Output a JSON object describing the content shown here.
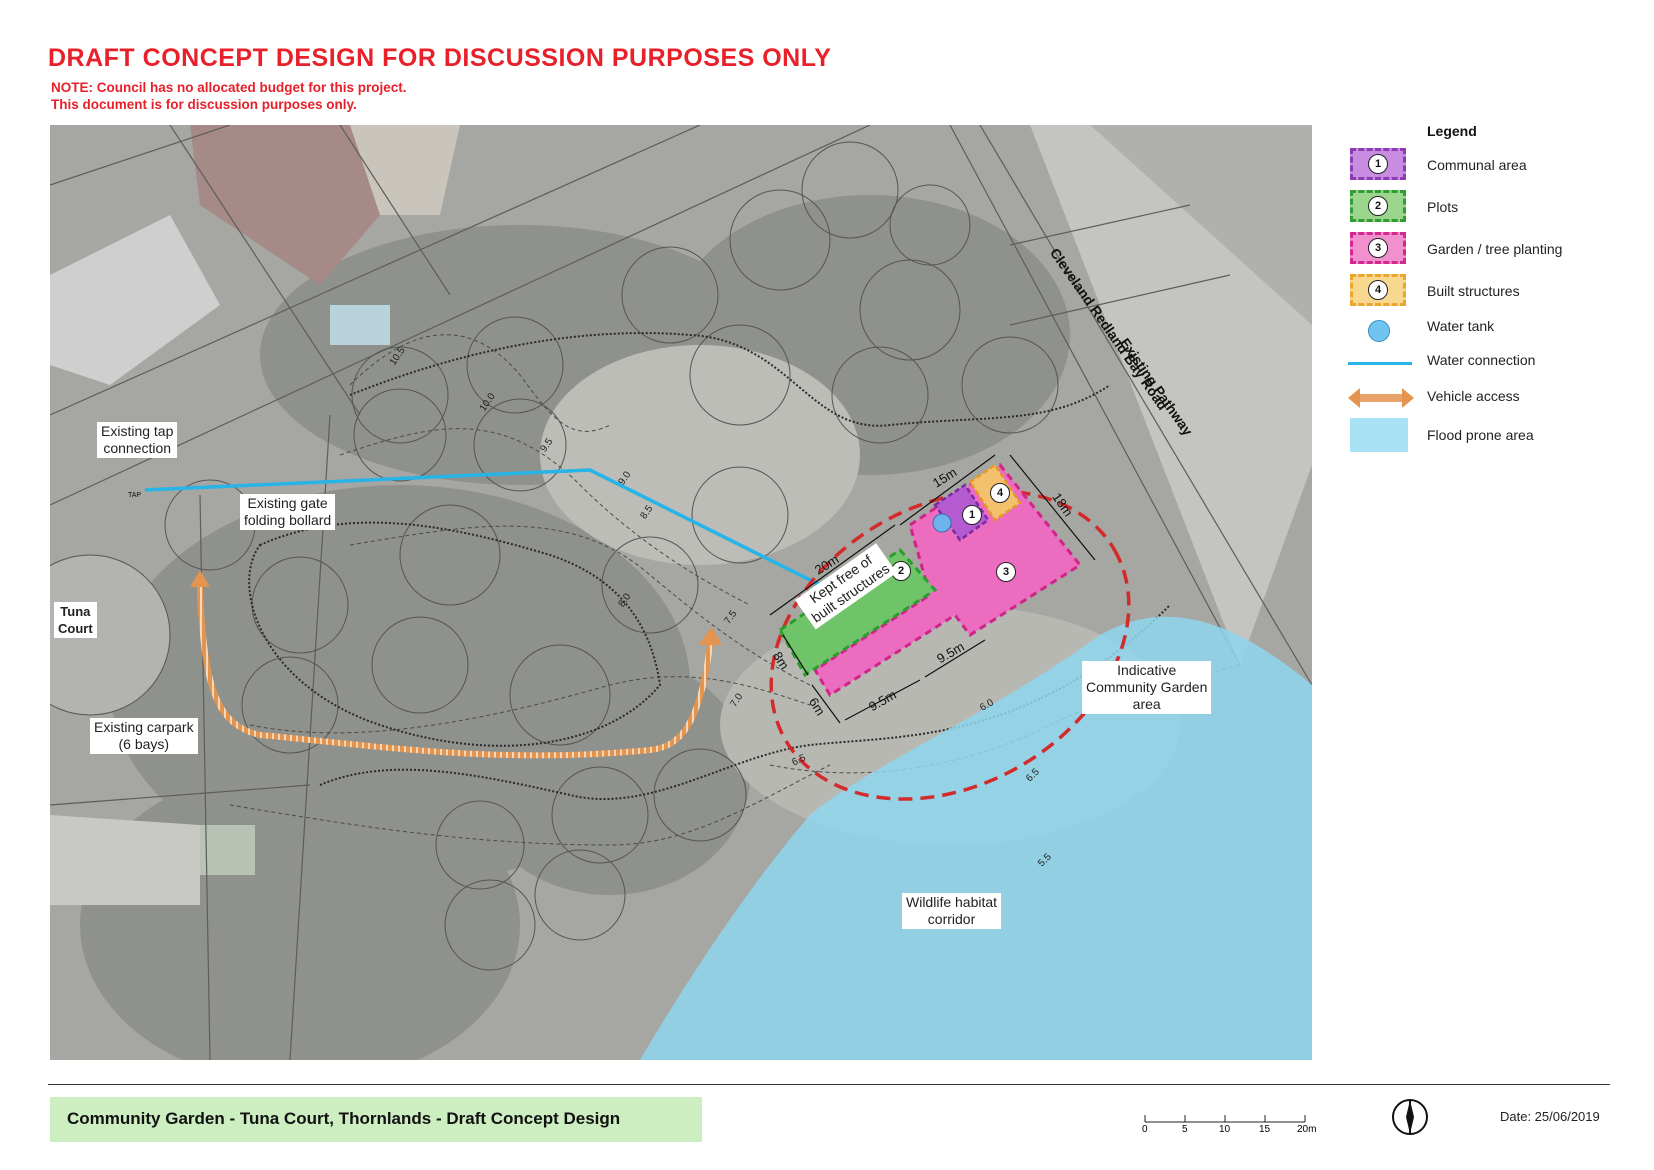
{
  "header": {
    "title": "DRAFT CONCEPT DESIGN FOR DISCUSSION PURPOSES ONLY",
    "note_line1": "NOTE: Council has no allocated budget for this project.",
    "note_line2": "This document is for discussion purposes only."
  },
  "map": {
    "road_label": "Cleveland Redland Bay Road",
    "pathway_label": "Existing Pathway",
    "tap_label_line1": "Existing tap",
    "tap_label_line2": "connection",
    "gate_label_line1": "Existing gate",
    "gate_label_line2": "folding bollard",
    "court_label_line1": "Tuna",
    "court_label_line2": "Court",
    "carpark_label_line1": "Existing carpark",
    "carpark_label_line2": "(6 bays)",
    "garden_area_label_line1": "Indicative",
    "garden_area_label_line2": "Community Garden",
    "garden_area_label_line3": "area",
    "wildlife_label_line1": "Wildlife habitat",
    "wildlife_label_line2": "corridor",
    "kept_free_line1": "Kept free of",
    "kept_free_line2": "built structures",
    "tap_code": "TAP",
    "dimensions": {
      "d15": "15m",
      "d18": "18m",
      "d20": "20m",
      "d8": "8m",
      "d6": "6m",
      "d95a": "9.5m",
      "d95b": "9.5m"
    },
    "contours": [
      "10.5",
      "10.0",
      "9.5",
      "9.0",
      "8.5",
      "8.0",
      "7.5",
      "7.0",
      "6.5",
      "6.0",
      "6.5",
      "5.5"
    ],
    "zone_numbers": [
      "1",
      "2",
      "3",
      "4"
    ],
    "colors": {
      "communal": "#a233c4",
      "plots": "#3fae3c",
      "garden": "#e6309a",
      "built": "#f0a82c",
      "water_tank": "#6fb3ec",
      "water_connection": "#27b4e6",
      "vehicle": "#e3944f",
      "flood": "#8fd6ee",
      "dashed_ellipse": "#d42a2a"
    }
  },
  "legend": {
    "title": "Legend",
    "items": [
      {
        "num": "1",
        "label": "Communal area"
      },
      {
        "num": "2",
        "label": "Plots"
      },
      {
        "num": "3",
        "label": "Garden / tree planting"
      },
      {
        "num": "4",
        "label": "Built structures"
      },
      {
        "num": "",
        "label": "Water tank"
      },
      {
        "num": "",
        "label": "Water connection"
      },
      {
        "num": "",
        "label": "Vehicle access"
      },
      {
        "num": "",
        "label": "Flood prone area"
      }
    ]
  },
  "footer": {
    "project_title": "Community Garden - Tuna Court, Thornlands - Draft Concept Design",
    "scale_ticks": [
      "0",
      "5",
      "10",
      "15",
      "20m"
    ],
    "date": "Date: 25/06/2019"
  }
}
